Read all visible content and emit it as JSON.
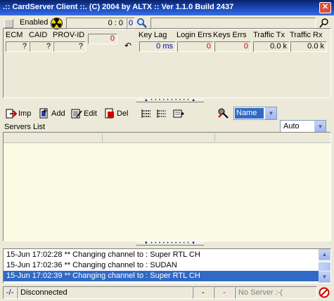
{
  "window": {
    "title": ".:: CardServer Client ::. (C) 2004 by ALTX :: Ver 1.1.0 Build 2437"
  },
  "top": {
    "enabled_label": "Enabled",
    "counter": "0 : 0",
    "counter2": "0"
  },
  "stats": {
    "headers": [
      "ECM",
      "CAID",
      "PROV-ID",
      "Key Lag",
      "Login Errs",
      "Keys Errs",
      "Traffic Tx",
      "Traffic Rx"
    ],
    "values": {
      "ecm": "?",
      "caid": "?",
      "prov_id": "?",
      "red_counter": "0",
      "key_lag": "0 ms",
      "login_errs": "0",
      "keys_errs": "0",
      "traffic_tx": "0.0 k",
      "traffic_rx": "0.0 k"
    }
  },
  "toolbar": {
    "imp_label": "Imp",
    "add_label": "Add",
    "edit_label": "Edit",
    "del_label": "Del",
    "sort_value": "Name",
    "mode_value": "Auto"
  },
  "servers": {
    "label": "Servers List"
  },
  "log": {
    "lines": [
      "15-Jun 17:02:28 ** Changing channel to : Super RTL CH",
      "15-Jun 17:02:36 ** Changing channel to : SUDAN",
      "15-Jun 17:02:39 ** Changing channel to : Super RTL CH"
    ],
    "selected_index": 2
  },
  "status": {
    "indicator": "-/-",
    "connection": "Disconnected",
    "dash1": "-",
    "dash2": "-",
    "server": "No Server :-("
  },
  "colors": {
    "title_bar": "#0a246a",
    "panel_bg": "#ece9d8",
    "list_bg": "#fbfbe4",
    "selection": "#316ac5",
    "error_red": "#d00000",
    "value_blue": "#0000c0"
  }
}
